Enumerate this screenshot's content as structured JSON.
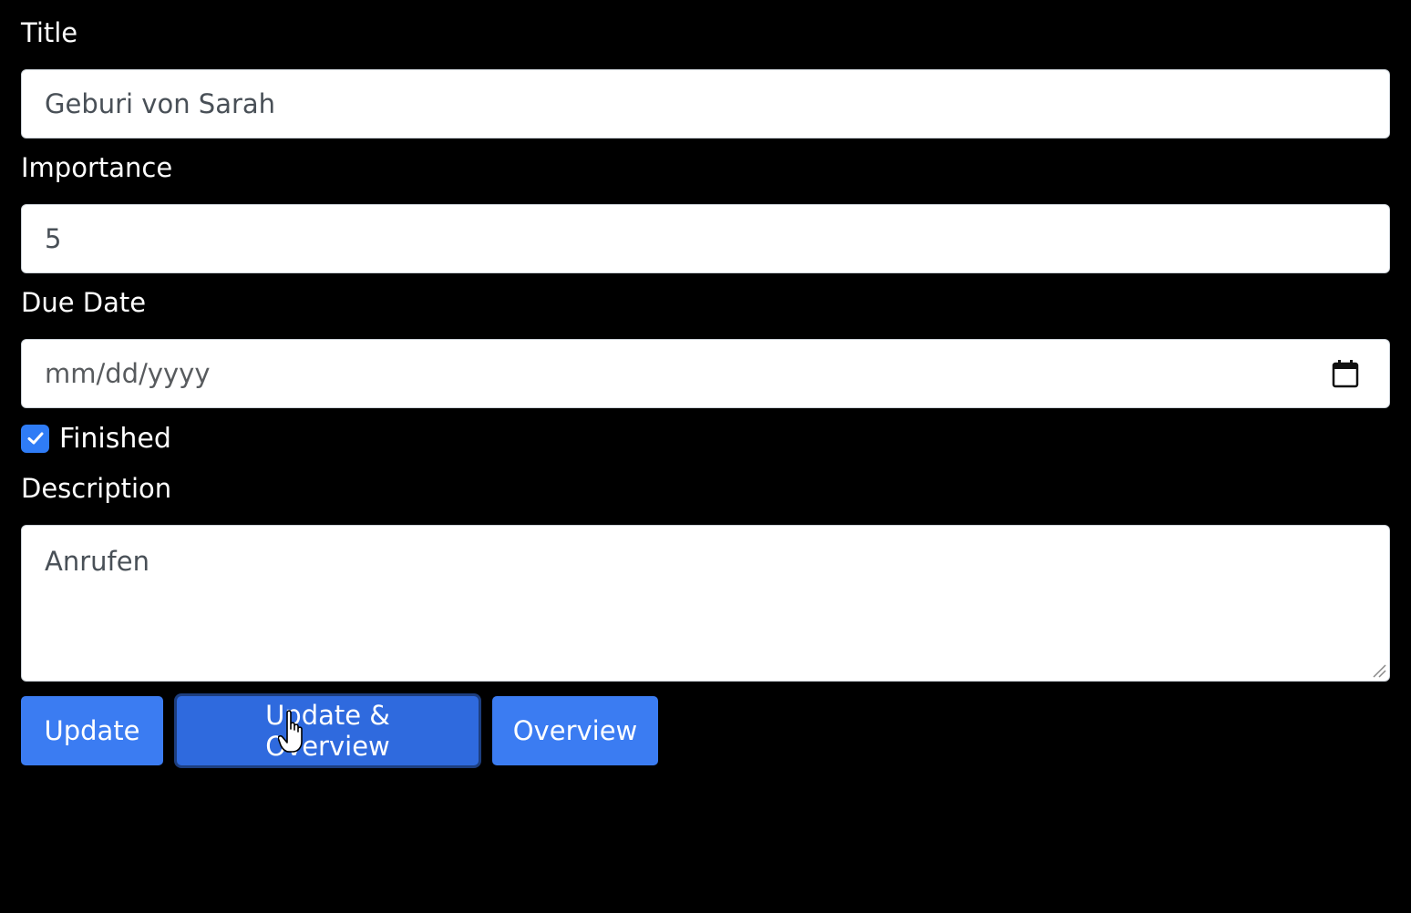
{
  "form": {
    "title": {
      "label": "Title",
      "value": "Geburi von Sarah"
    },
    "importance": {
      "label": "Importance",
      "value": "5"
    },
    "due_date": {
      "label": "Due Date",
      "placeholder": "mm/dd/yyyy",
      "icon": "calendar-icon"
    },
    "finished": {
      "label": "Finished",
      "checked": true
    },
    "description": {
      "label": "Description",
      "value": "Anrufen"
    }
  },
  "buttons": {
    "update_label": "Update",
    "update_overview_label": "Update & Overview",
    "overview_label": "Overview"
  },
  "colors": {
    "background": "#000000",
    "primary": "#3b7cf2",
    "primary_active": "#2f6ade",
    "field_text": "#495057"
  }
}
